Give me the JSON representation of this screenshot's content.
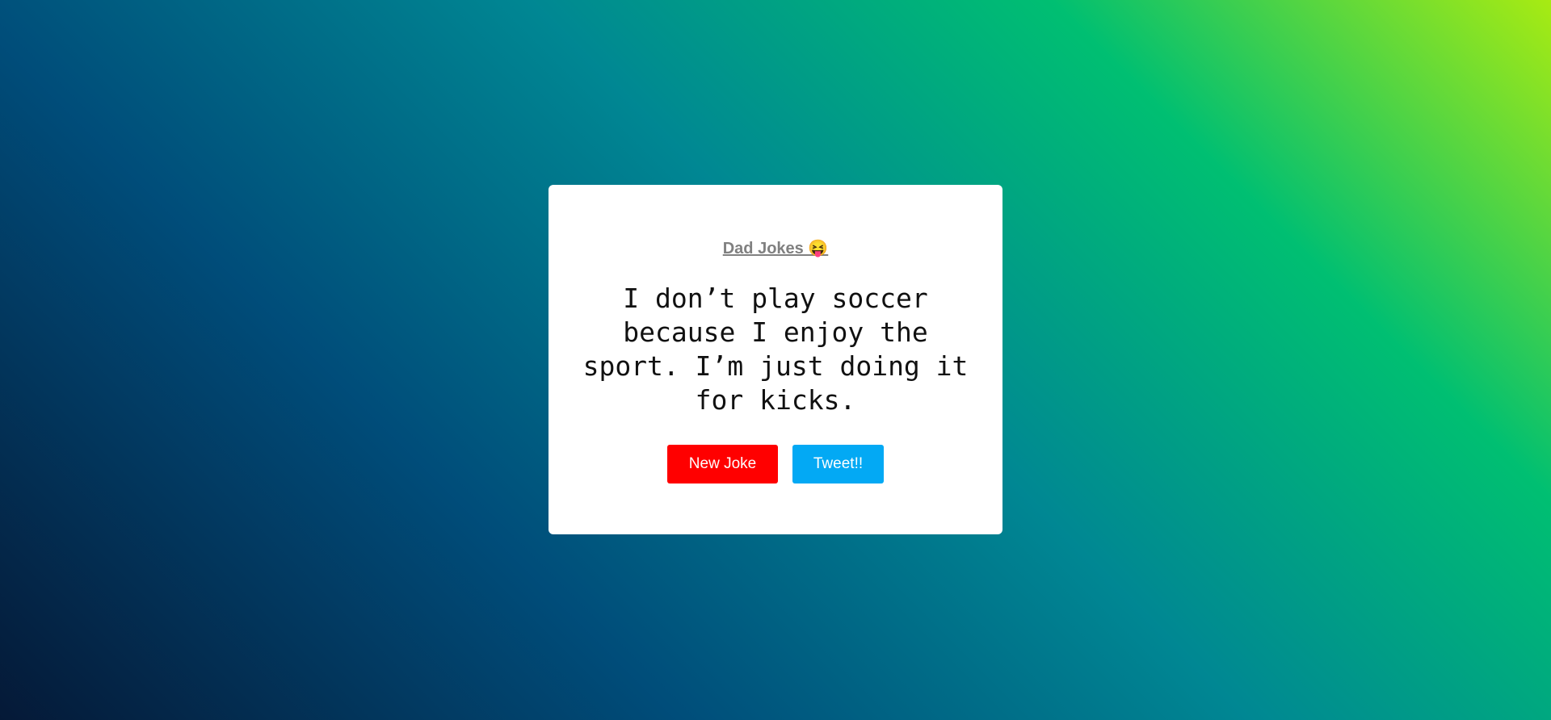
{
  "card": {
    "title": "Dad Jokes 😝",
    "joke": "I don’t play soccer because I enjoy the sport. I’m just doing it for kicks.",
    "new_joke_label": "New Joke",
    "tweet_label": "Tweet!!"
  },
  "colors": {
    "new_joke_button": "#ff0000",
    "tweet_button": "#03a9f4",
    "title_text": "#808080"
  }
}
